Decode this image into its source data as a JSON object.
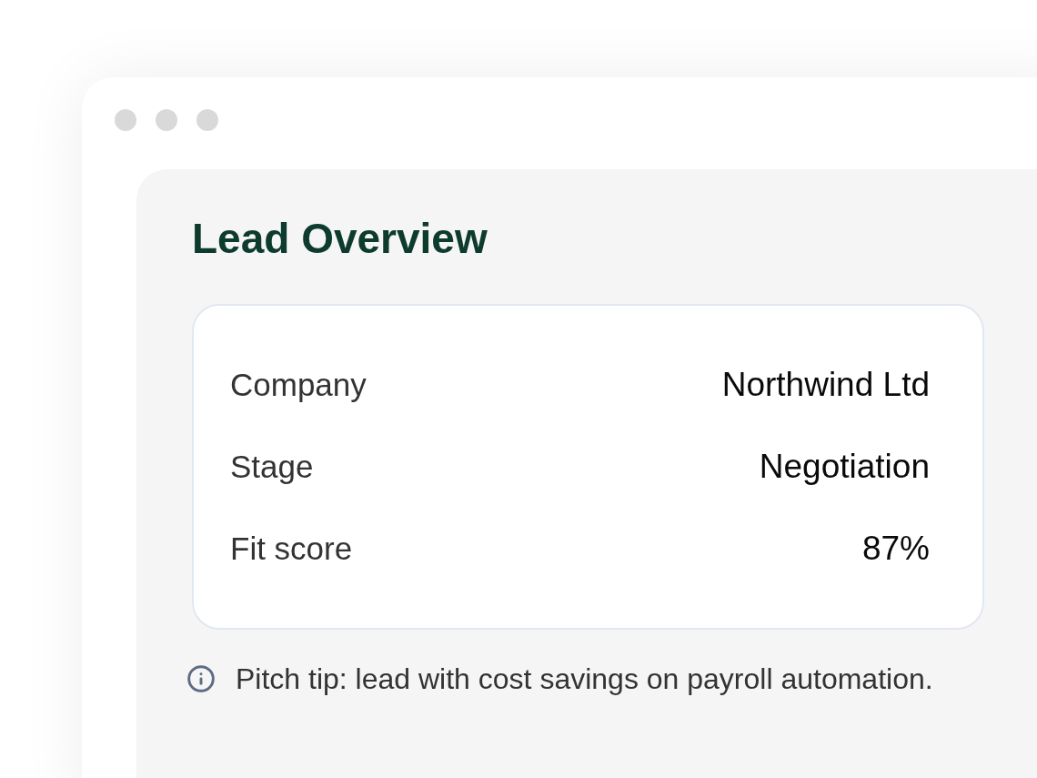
{
  "title": "Lead Overview",
  "fields": [
    {
      "label": "Company",
      "value": "Northwind Ltd"
    },
    {
      "label": "Stage",
      "value": "Negotiation"
    },
    {
      "label": "Fit score",
      "value": "87%"
    }
  ],
  "tip": {
    "text": "Pitch tip: lead with cost savings on payroll automation."
  }
}
